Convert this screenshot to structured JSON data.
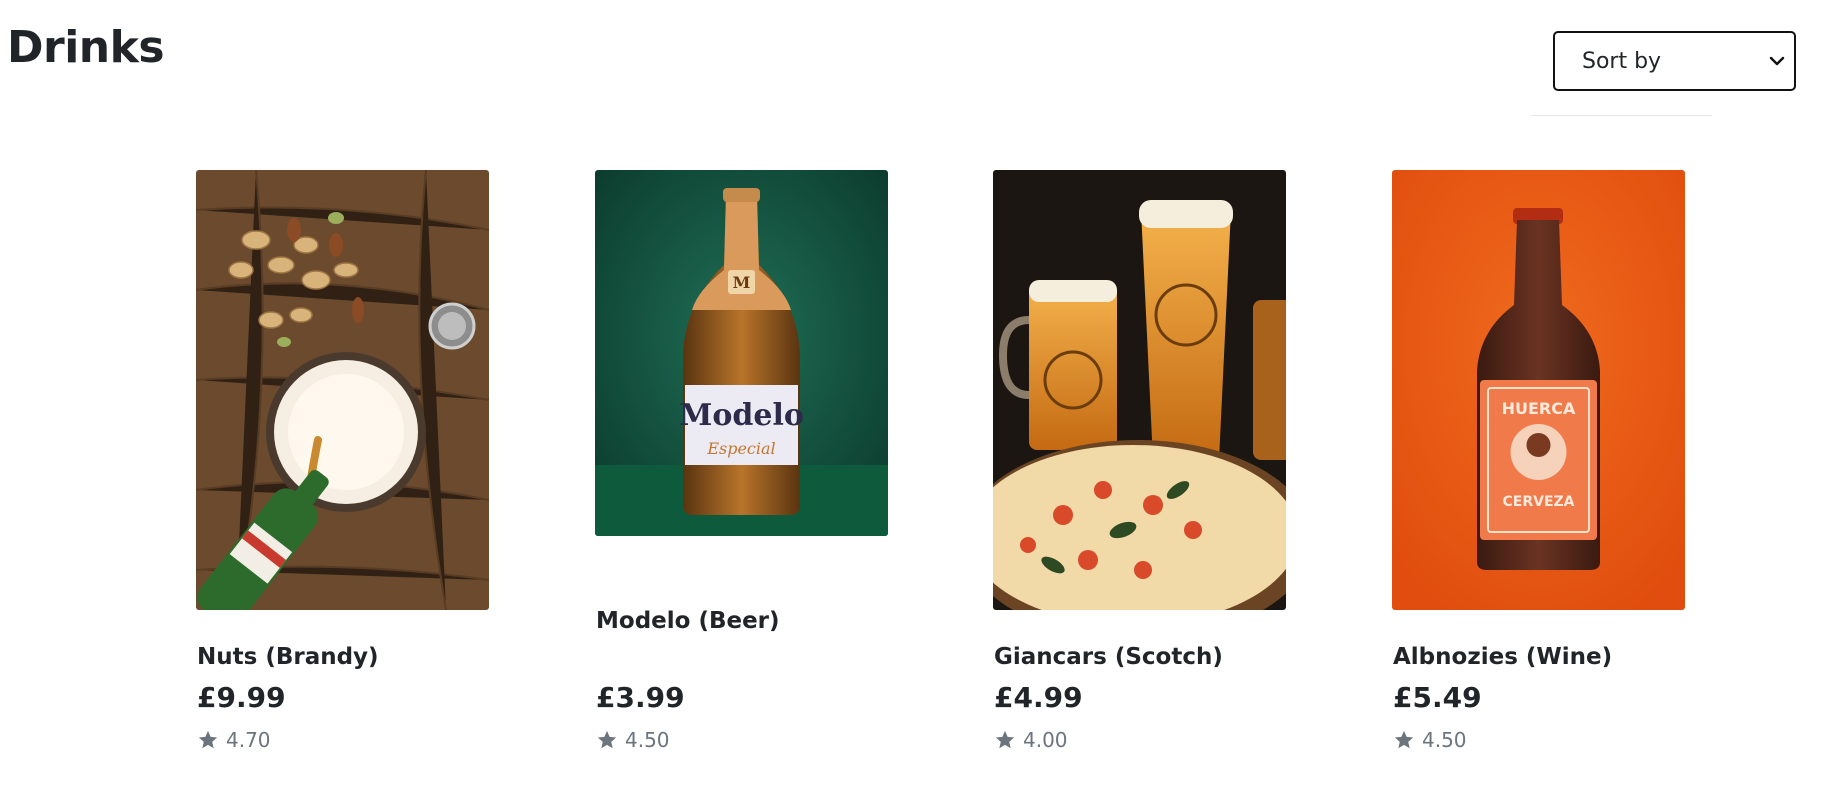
{
  "page": {
    "title": "Drinks"
  },
  "sort": {
    "label": "Sort by",
    "icon": "chevron-down-icon"
  },
  "products": [
    {
      "name": "Nuts (Brandy)",
      "price": "£9.99",
      "rating": "4.70",
      "image": "beer-and-nuts-photo"
    },
    {
      "name": "Modelo (Beer)",
      "price": "£3.99",
      "rating": "4.50",
      "image": "modelo-bottle-photo"
    },
    {
      "name": "Giancars (Scotch)",
      "price": "£4.99",
      "rating": "4.00",
      "image": "beers-and-pizza-photo"
    },
    {
      "name": "Albnozies (Wine)",
      "price": "£5.49",
      "rating": "4.50",
      "image": "amber-bottle-photo"
    }
  ],
  "colors": {
    "text": "#212529",
    "muted": "#6c757d",
    "star": "#6c757d"
  }
}
